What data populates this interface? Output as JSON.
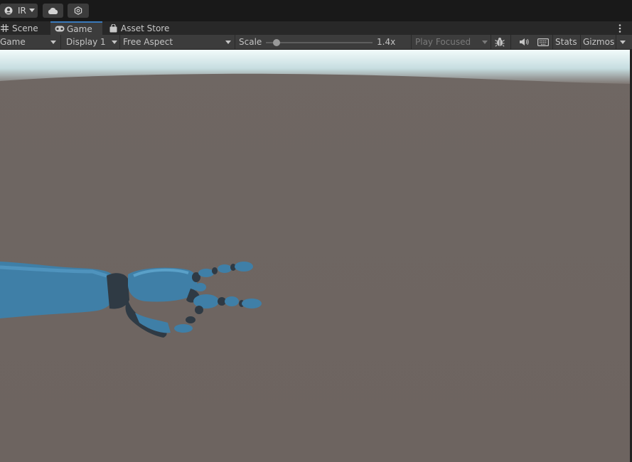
{
  "topbar": {
    "account_label": "IR",
    "icons": {
      "account": "person-icon",
      "cloud": "cloud-icon",
      "services": "services-icon"
    }
  },
  "tabs": [
    {
      "label": "Scene",
      "icon": "grid-icon",
      "active": false
    },
    {
      "label": "Game",
      "icon": "gamepad-icon",
      "active": true
    },
    {
      "label": "Asset Store",
      "icon": "bag-icon",
      "active": false
    }
  ],
  "toolbar": {
    "game_dropdown": "Game",
    "display_dropdown": "Display 1",
    "aspect_dropdown": "Free Aspect",
    "scale_label": "Scale",
    "scale_value_label": "1.4x",
    "scale_value": 1.4,
    "scale_min": 1,
    "scale_max": 5,
    "play_mode_dropdown": "Play Focused",
    "stats_label": "Stats",
    "gizmos_label": "Gizmos",
    "icons": {
      "debug": "bug-icon",
      "audio": "speaker-icon",
      "shortcuts": "keyboard-icon"
    }
  },
  "colors": {
    "accent": "#3a79bb",
    "hand": "#3f7fa7",
    "hand_dark_joint": "#2f3a44",
    "floor": "#6e6561",
    "sky": "#e6f3f4"
  }
}
